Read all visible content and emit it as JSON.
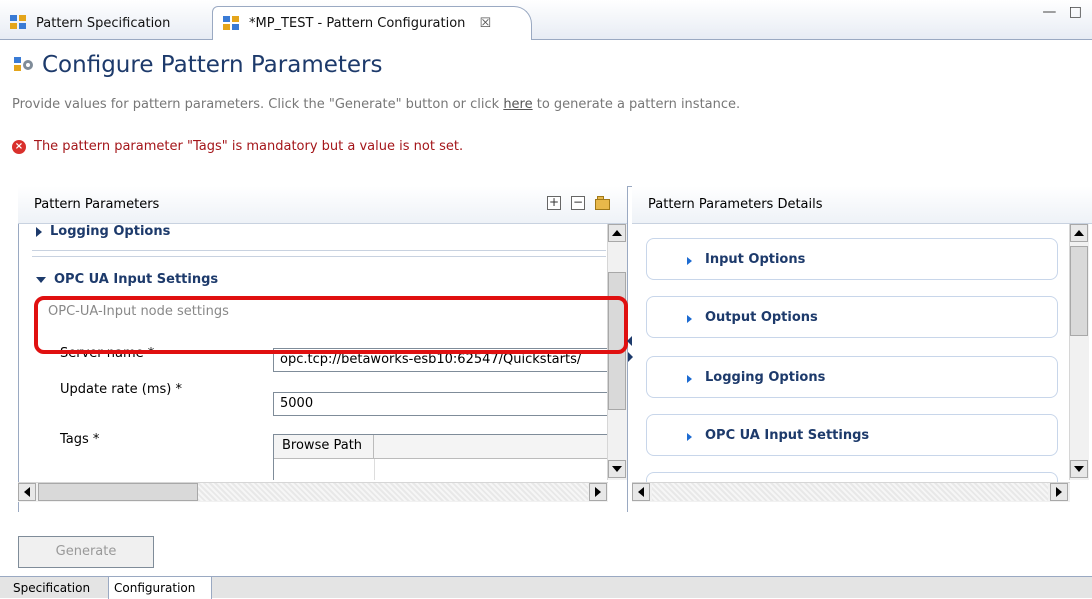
{
  "tabs": [
    {
      "label": "Pattern Specification"
    },
    {
      "label": "*MP_TEST - Pattern Configuration",
      "close": "☒"
    }
  ],
  "window_controls": "— □",
  "header": {
    "title": "Configure Pattern Parameters",
    "description_before": "Provide values for pattern parameters. Click the \"Generate\" button or click ",
    "description_link": "here",
    "description_after": " to generate a pattern instance.",
    "error": "The pattern parameter \"Tags\" is mandatory but a value is not set."
  },
  "left_panel": {
    "title": "Pattern Parameters",
    "tools": {
      "expand": "+",
      "collapse": "−"
    },
    "sections": {
      "logging": "Logging Options",
      "opc": "OPC UA Input Settings"
    },
    "subdesc": "OPC-UA-Input node settings",
    "fields": {
      "server_name_label": "Server name *",
      "server_name_value": "opc.tcp://betaworks-esb10:62547/Quickstarts/",
      "update_rate_label": "Update rate (ms) *",
      "update_rate_value": "5000",
      "tags_label": "Tags *",
      "tags_column": "Browse Path"
    }
  },
  "right_panel": {
    "title": "Pattern Parameters Details",
    "cards": [
      "Input Options",
      "Output Options",
      "Logging Options",
      "OPC UA Input Settings"
    ]
  },
  "footer": {
    "generate": "Generate",
    "tabs": [
      "Specification",
      "Configuration"
    ]
  },
  "colors": {
    "accent": "#1d3a6b",
    "error": "#a4161a",
    "highlight": "#e01010"
  }
}
